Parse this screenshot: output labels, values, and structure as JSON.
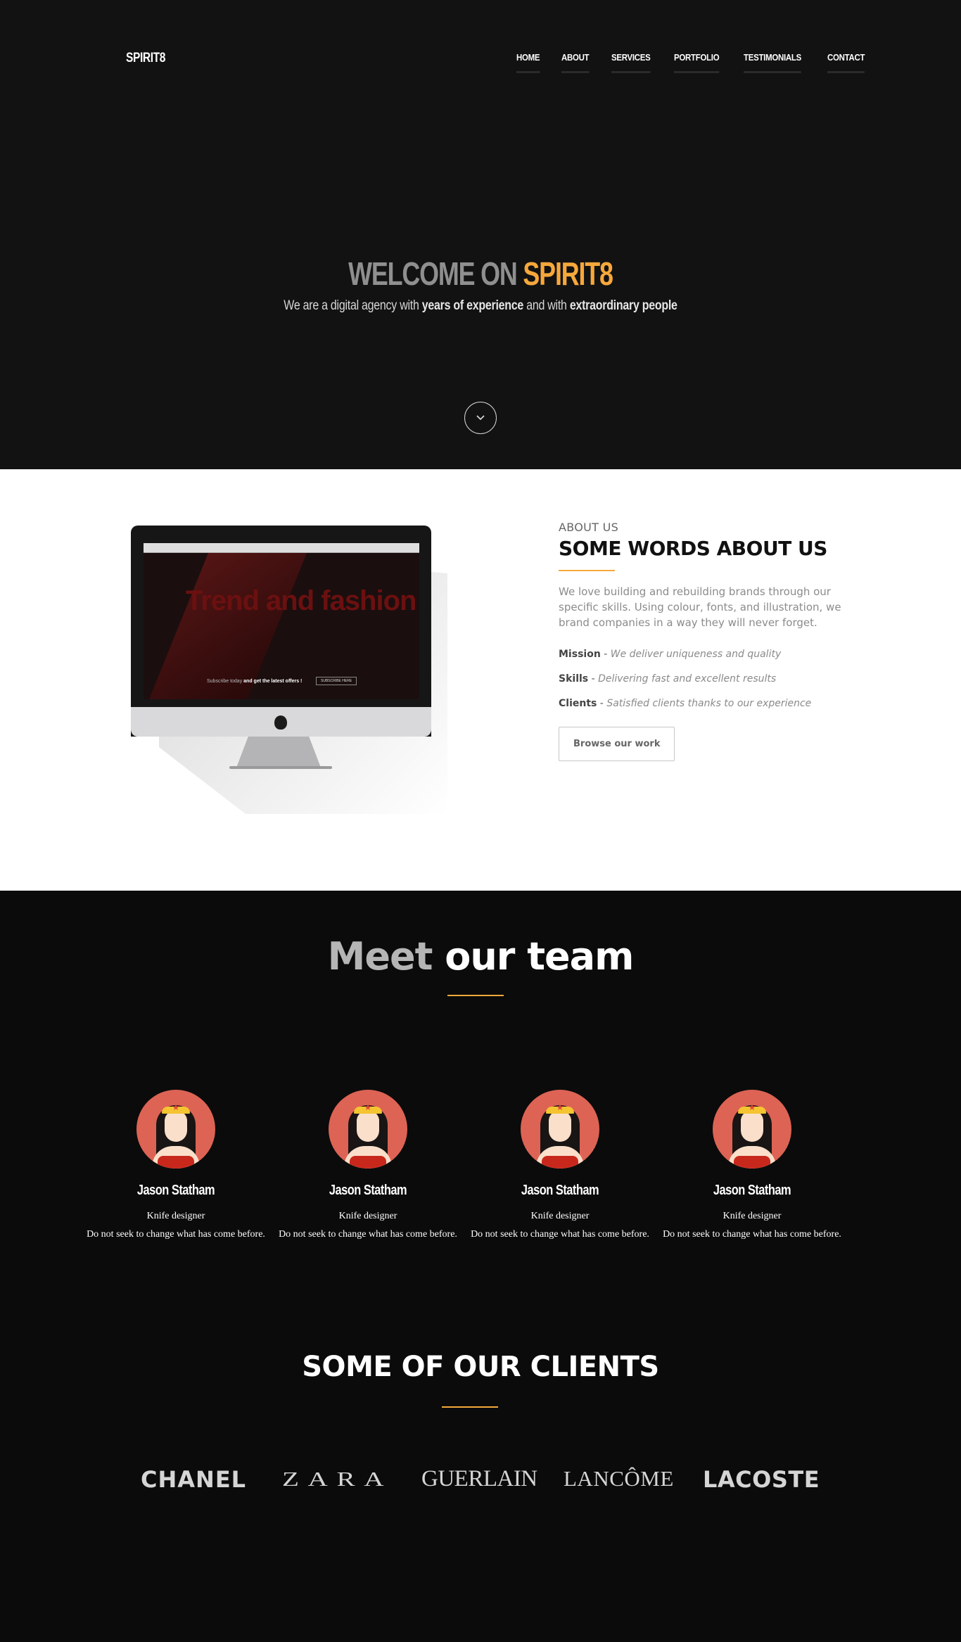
{
  "header": {
    "logo": "SPIRIT8",
    "nav": [
      "HOME",
      "ABOUT",
      "SERVICES",
      "PORTFOLIO",
      "TESTIMONIALS",
      "CONTACT"
    ]
  },
  "hero": {
    "title_part1": "WELCOME ON",
    "title_part2": "SPIRIT8",
    "sub_a": "We are a digital agency with",
    "sub_b": "years of experience",
    "sub_c": "and with",
    "sub_d": "extraordinary people",
    "scroll_icon": "chevron-down-icon"
  },
  "about": {
    "eyebrow": "ABOUT US",
    "heading_a": "SOME WORDS",
    "heading_b": "ABOUT US",
    "paragraph": "We love building and rebuilding brands through our specific skills. Using colour, fonts, and illustration, we brand companies in a way they will never forget.",
    "items": [
      {
        "label": "Mission",
        "text": "We deliver uniqueness and quality"
      },
      {
        "label": "Skills",
        "text": "Delivering fast and excellent results"
      },
      {
        "label": "Clients",
        "text": "Satisfied clients thanks to our experience"
      }
    ],
    "button": "Browse our work",
    "screen": {
      "headline": "Trend and fashion",
      "subscribe_a": "Subscribe today",
      "subscribe_b": "and get the latest offers !",
      "subscribe_btn": "SUBSCRIBE HERE"
    }
  },
  "team": {
    "title_a": "Meet",
    "title_b": "our team",
    "members": [
      {
        "name": "Jason Statham",
        "role": "Knife designer",
        "desc": "Do not seek to change what has come before."
      },
      {
        "name": "Jason Statham",
        "role": "Knife designer",
        "desc": "Do not seek to change what has come before."
      },
      {
        "name": "Jason Statham",
        "role": "Knife designer",
        "desc": "Do not seek to change what has come before."
      },
      {
        "name": "Jason Statham",
        "role": "Knife designer",
        "desc": "Do not seek to change what has come before."
      }
    ]
  },
  "clients": {
    "title_a": "SOME OF",
    "title_b": "OUR CLIENTS",
    "logos": [
      "CHANEL",
      "ZARA",
      "GUERLAIN",
      "LANCÔME",
      "LACOSTE"
    ]
  },
  "colors": {
    "accent": "#f7a83b",
    "dark_bg": "#121213",
    "avatar_bg": "#dd6354"
  }
}
